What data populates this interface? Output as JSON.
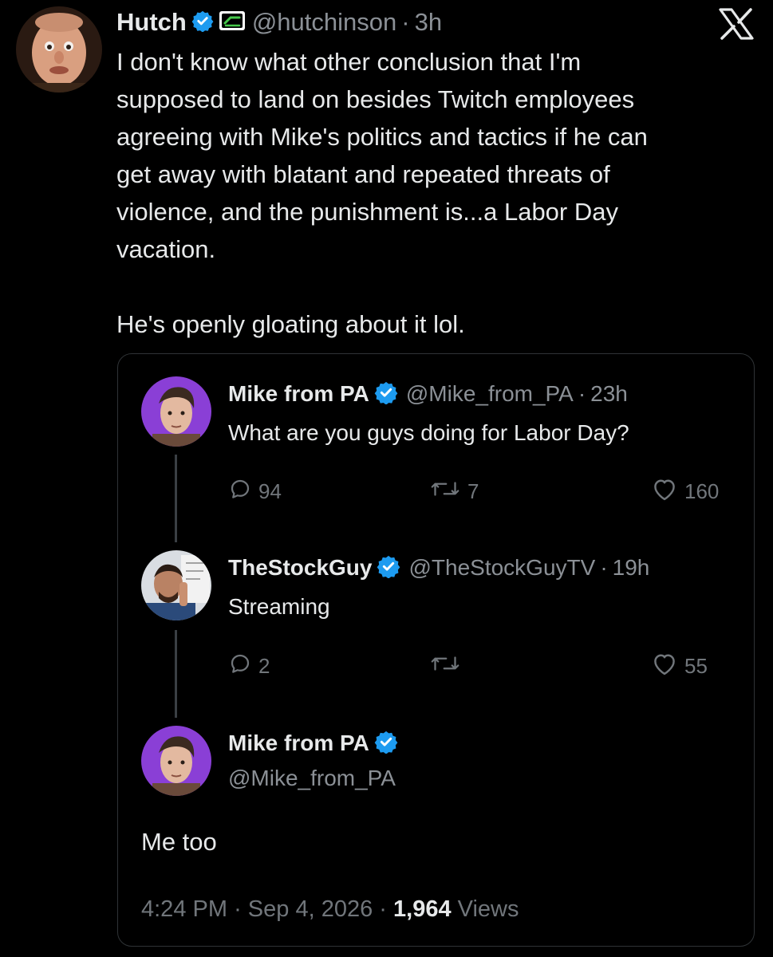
{
  "tweet": {
    "author_name": "Hutch",
    "author_handle": "@hutchinson",
    "time_separator": "·",
    "time": "3h",
    "text": "I don't know what other conclusion that I'm\nsupposed to land on besides Twitch employees\nagreeing with Mike's politics and tactics if he can\nget away with blatant and repeated threats of\nviolence, and the punishment is...a Labor Day\nvacation.\n\nHe's openly gloating about it lol."
  },
  "quoted_thread": [
    {
      "name": "Mike from PA",
      "handle": "@Mike_from_PA",
      "separator": "·",
      "time": "23h",
      "text": "What are you guys doing for Labor Day?",
      "replies": "94",
      "reposts": "7",
      "likes": "160"
    },
    {
      "name": "TheStockGuy",
      "handle": "@TheStockGuyTV",
      "separator": "·",
      "time": "19h",
      "text": "Streaming",
      "replies": "2",
      "reposts": "",
      "likes": "55"
    }
  ],
  "reply": {
    "name": "Mike from PA",
    "handle": "@Mike_from_PA",
    "text": "Me too",
    "time": "4:24 PM",
    "sep1": "·",
    "date": "Sep 4, 2026",
    "sep2": "·",
    "views": "1,964",
    "views_label": "Views"
  },
  "colors": {
    "background": "#000000",
    "text_primary": "#e7e9ea",
    "text_secondary": "#71767b",
    "verified_blue": "#1d9bf0",
    "border": "#2f3336"
  },
  "icons": {
    "verified": "verified-badge-icon",
    "affiliate": "affiliate-logo-icon",
    "platform_logo": "x-logo-icon",
    "reply": "reply-icon",
    "repost": "repost-icon",
    "like": "heart-icon"
  }
}
